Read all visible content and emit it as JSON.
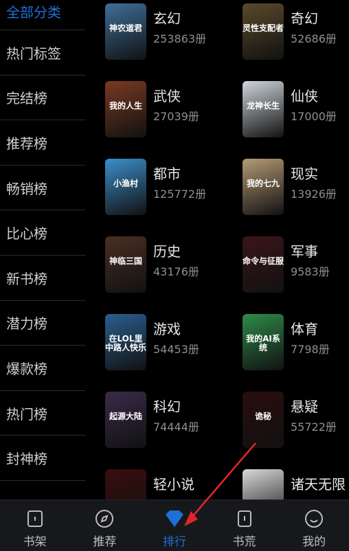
{
  "sidebar": {
    "items": [
      {
        "label": "全部分类",
        "active": true
      },
      {
        "label": "热门标签"
      },
      {
        "label": "完结榜"
      },
      {
        "label": "推荐榜"
      },
      {
        "label": "畅销榜"
      },
      {
        "label": "比心榜"
      },
      {
        "label": "新书榜"
      },
      {
        "label": "潜力榜"
      },
      {
        "label": "爆款榜"
      },
      {
        "label": "热门榜"
      },
      {
        "label": "封神榜"
      }
    ]
  },
  "categories": [
    {
      "name": "玄幻",
      "count": "253863册",
      "cover_text": "神农道君",
      "cover_color": "#3f6f9a"
    },
    {
      "name": "奇幻",
      "count": "52686册",
      "cover_text": "灵性支配者",
      "cover_color": "#5a4a2a"
    },
    {
      "name": "武侠",
      "count": "27039册",
      "cover_text": "我的人生",
      "cover_color": "#7a3a20"
    },
    {
      "name": "仙侠",
      "count": "17000册",
      "cover_text": "龙神长生",
      "cover_color": "#cfd6dc"
    },
    {
      "name": "都市",
      "count": "125772册",
      "cover_text": "小渔村",
      "cover_color": "#3b8fc9"
    },
    {
      "name": "现实",
      "count": "13926册",
      "cover_text": "我的七九",
      "cover_color": "#b49a74"
    },
    {
      "name": "历史",
      "count": "43176册",
      "cover_text": "神临三国",
      "cover_color": "#4a2f22"
    },
    {
      "name": "军事",
      "count": "9583册",
      "cover_text": "命令与征服",
      "cover_color": "#3a1518"
    },
    {
      "name": "游戏",
      "count": "54453册",
      "cover_text": "在LOL里中路人快乐",
      "cover_color": "#2a5f8e"
    },
    {
      "name": "体育",
      "count": "7798册",
      "cover_text": "我的AI系统",
      "cover_color": "#2f8a4a"
    },
    {
      "name": "科幻",
      "count": "74444册",
      "cover_text": "起源大陆",
      "cover_color": "#3a2a4a"
    },
    {
      "name": "悬疑",
      "count": "55722册",
      "cover_text": "诡秘",
      "cover_color": "#2a0d0d"
    },
    {
      "name": "轻小说",
      "count": "",
      "cover_text": "",
      "cover_color": "#3a0d0d"
    },
    {
      "name": "诸天无限",
      "count": "",
      "cover_text": "",
      "cover_color": "#d8d8d8"
    }
  ],
  "tabs": [
    {
      "label": "书架",
      "icon": "bookshelf-icon"
    },
    {
      "label": "推荐",
      "icon": "compass-icon"
    },
    {
      "label": "排行",
      "icon": "diamond-icon",
      "active": true
    },
    {
      "label": "书荒",
      "icon": "book-icon"
    },
    {
      "label": "我的",
      "icon": "smile-icon"
    }
  ],
  "colors": {
    "accent": "#1f6fd6",
    "annotation_arrow": "#e0262b",
    "tabbar_bg": "#16181c"
  }
}
